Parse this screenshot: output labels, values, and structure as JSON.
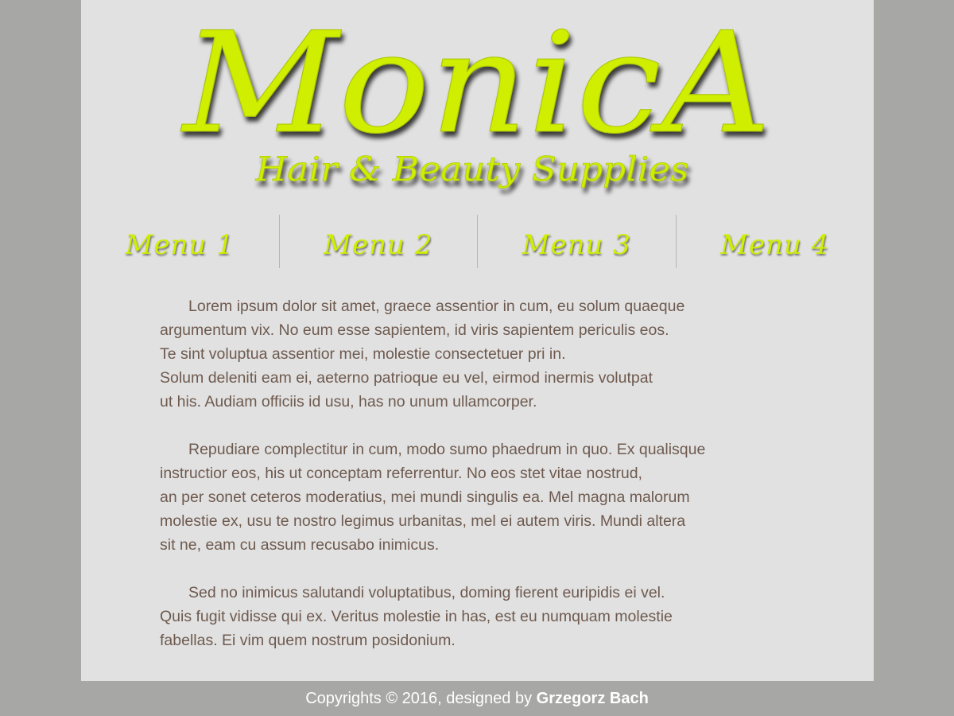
{
  "brand": {
    "title": "MonicA",
    "subtitle": "Hair & Beauty Supplies",
    "accent_color": "#cfee00"
  },
  "nav": {
    "items": [
      {
        "label": "Menu 1"
      },
      {
        "label": "Menu 2"
      },
      {
        "label": "Menu 3"
      },
      {
        "label": "Menu 4"
      }
    ]
  },
  "content": {
    "paragraphs": [
      {
        "lines": [
          "Lorem ipsum dolor sit amet, graece assentior in cum, eu solum quaeque",
          "argumentum vix. No eum esse sapientem, id viris sapientem periculis eos.",
          "Te sint voluptua assentior mei, molestie consectetuer pri in.",
          "Solum deleniti eam ei, aeterno patrioque eu vel, eirmod inermis volutpat",
          "ut his. Audiam officiis id usu, has no unum ullamcorper."
        ]
      },
      {
        "lines": [
          "Repudiare complectitur in cum, modo sumo phaedrum in quo. Ex qualisque",
          "instructior eos, his ut conceptam referrentur. No eos stet vitae nostrud,",
          "an per sonet ceteros moderatius, mei mundi singulis ea. Mel magna malorum",
          "molestie ex, usu te nostro legimus urbanitas, mel ei autem viris. Mundi altera",
          "sit ne, eam cu assum recusabo inimicus."
        ]
      },
      {
        "lines": [
          "Sed no inimicus salutandi voluptatibus, doming fierent euripidis ei vel.",
          "Quis fugit vidisse qui ex. Veritus molestie in has, est eu numquam molestie",
          "fabellas. Ei vim quem nostrum posidonium."
        ]
      }
    ]
  },
  "footer": {
    "prefix": "Copyrights © 2016, designed by ",
    "author": "Grzegorz Bach"
  }
}
